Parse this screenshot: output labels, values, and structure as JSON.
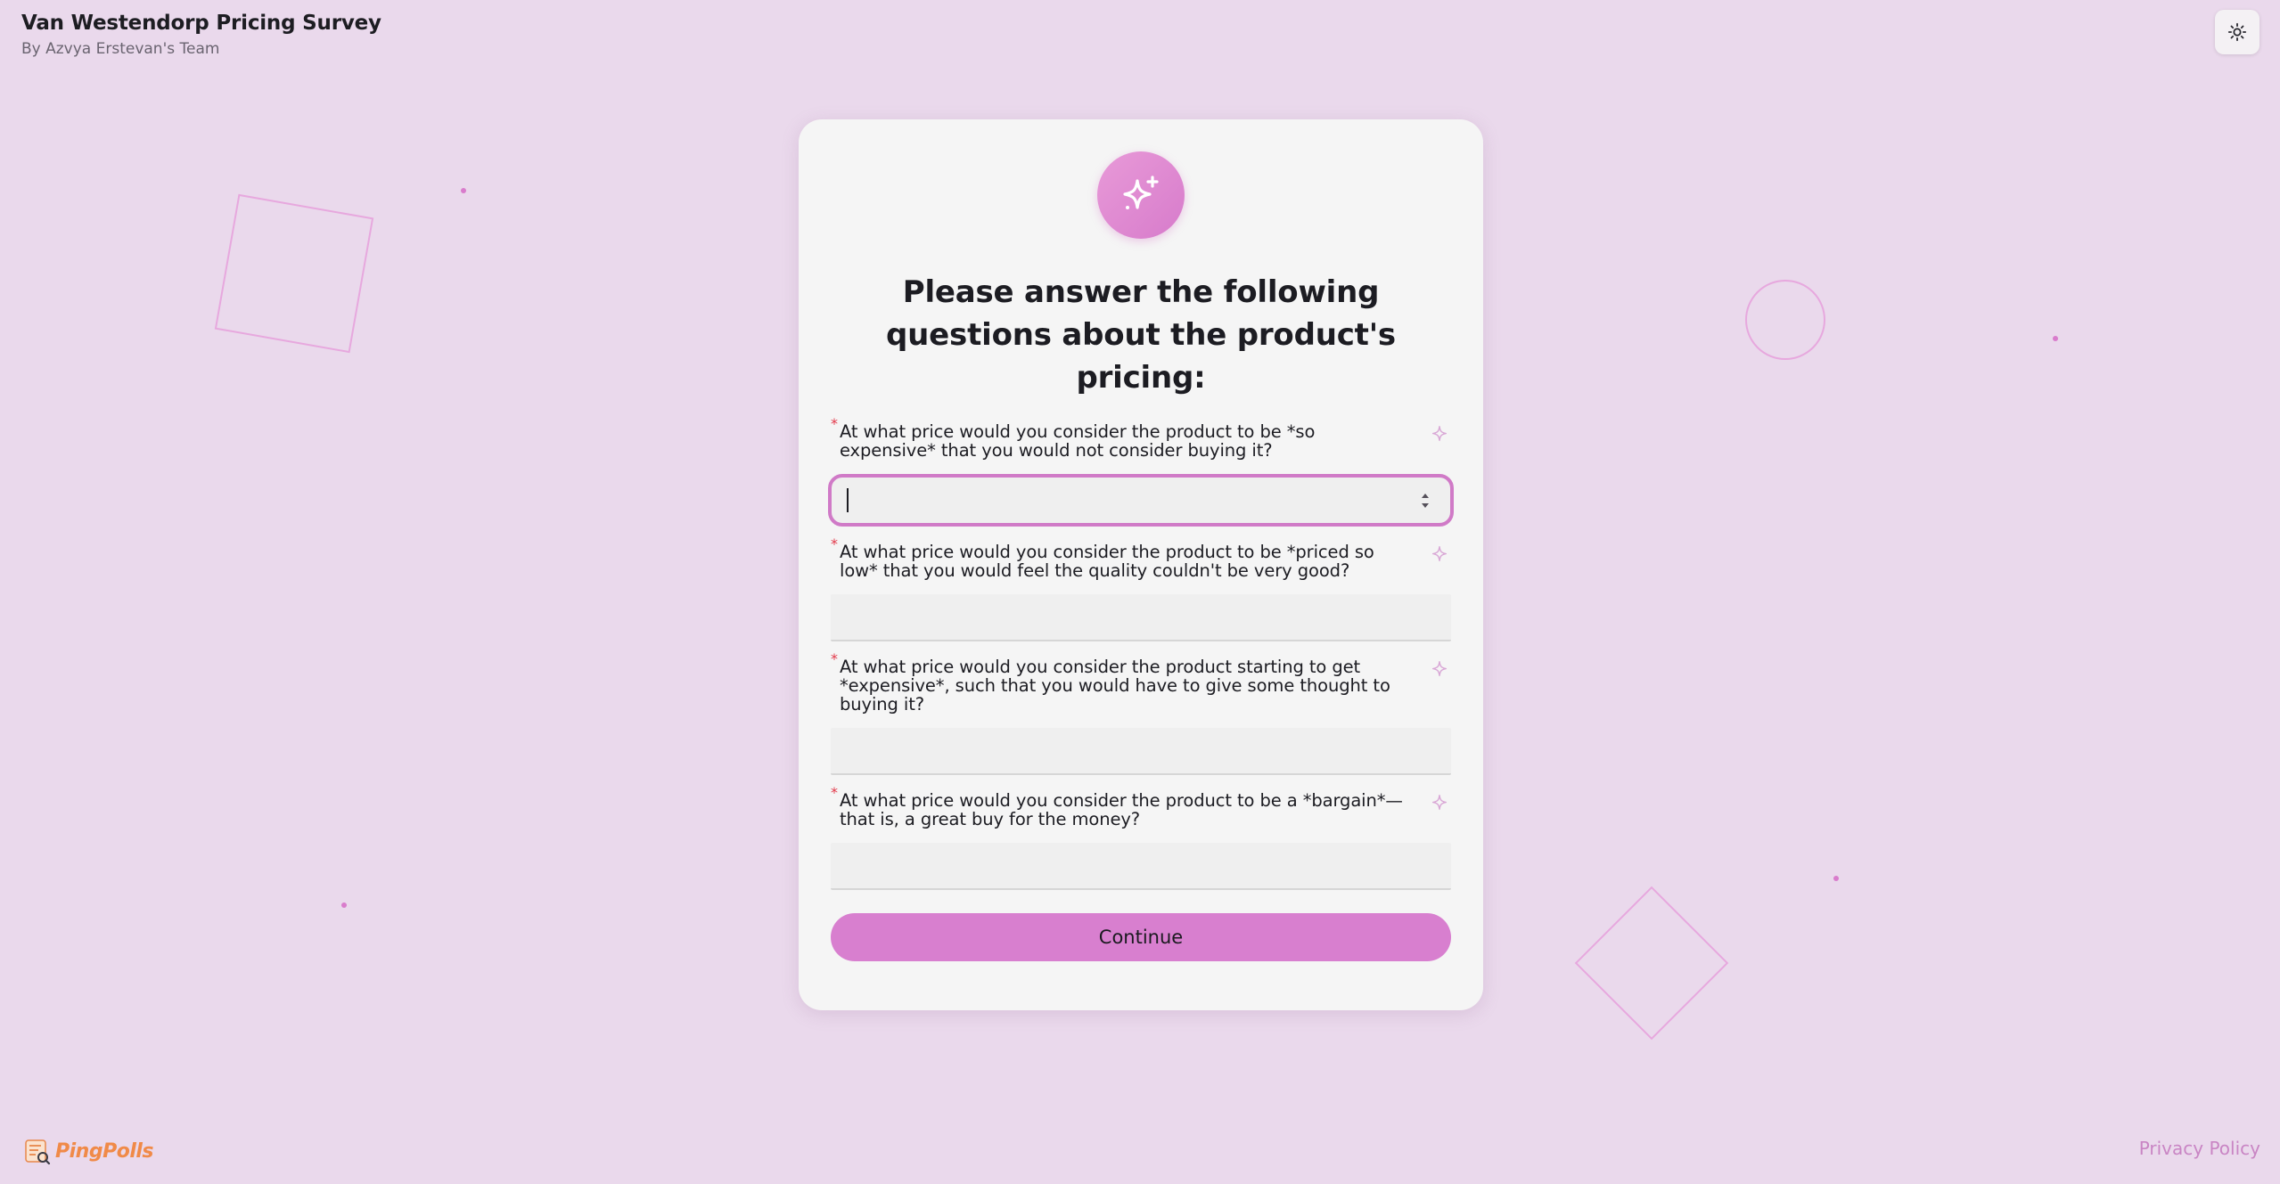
{
  "header": {
    "title": "Van Westendorp Pricing Survey",
    "author": "By Azvya Erstevan's Team"
  },
  "theme_toggle": {
    "icon": "sun-icon"
  },
  "card": {
    "badge_icon": "sparkles-icon",
    "heading": "Please answer the following questions about the product's pricing:",
    "questions": [
      {
        "required_mark": "*",
        "text": "At what price would you consider the product to be *so expensive* that you would not consider buying it?",
        "value": "",
        "focused": true
      },
      {
        "required_mark": "*",
        "text": "At what price would you consider the product to be *priced so low* that you would feel the quality couldn't be very good?",
        "value": "",
        "focused": false
      },
      {
        "required_mark": "*",
        "text": "At what price would you consider the product starting to get *expensive*, such that you would have to give some thought to buying it?",
        "value": "",
        "focused": false
      },
      {
        "required_mark": "*",
        "text": "At what price would you consider the product to be a *bargain*—that is, a great buy for the money?",
        "value": "",
        "focused": false
      }
    ],
    "continue_label": "Continue"
  },
  "footer": {
    "brand_name": "PingPolls",
    "privacy_label": "Privacy Policy"
  },
  "colors": {
    "background": "#ead9ec",
    "accent": "#d87fcf",
    "required": "#e3394a",
    "brand": "#f08a48"
  }
}
